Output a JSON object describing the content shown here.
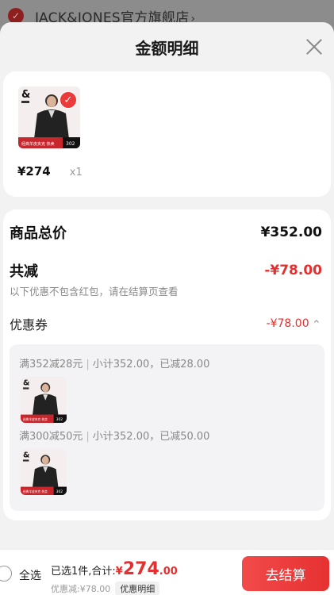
{
  "background_shop": {
    "name": "JACK&JONES官方旗舰店",
    "chevron": "›"
  },
  "sheet": {
    "title": "金额明细"
  },
  "product": {
    "price": "¥274",
    "qty": "x1",
    "check_mark": "✓",
    "thumb_brand": "&",
    "thumb_caption": "经典羊皮夹克 热卖",
    "thumb_tag": "302"
  },
  "details": {
    "total_label": "商品总价",
    "total_value": "¥352.00",
    "reduce_label": "共减",
    "reduce_value": "-¥78.00",
    "reduce_note": "以下优惠不包含红包，请在结算页查看",
    "coupon_label": "优惠券",
    "coupon_value": "-¥78.00",
    "coupon_chevron": "^",
    "coupons": [
      {
        "rule": "满352减28元",
        "detail": "小计352.00，已减28.00",
        "sep": "|"
      },
      {
        "rule": "满300减50元",
        "detail": "小计352.00，已减50.00",
        "sep": "|"
      }
    ]
  },
  "bottom_bar": {
    "select_all": "全选",
    "summary_prefix": "已选1件,合计:",
    "sum_yen": "¥",
    "sum_int": "274",
    "sum_dec": ".00",
    "discount_text": "优惠减:¥78.00",
    "detail_button": "优惠明细",
    "checkout_button": "去结算"
  },
  "colors": {
    "accent": "#e62f2f",
    "check_badge": "#ea3a3a",
    "checkout": "#f24a4a"
  }
}
